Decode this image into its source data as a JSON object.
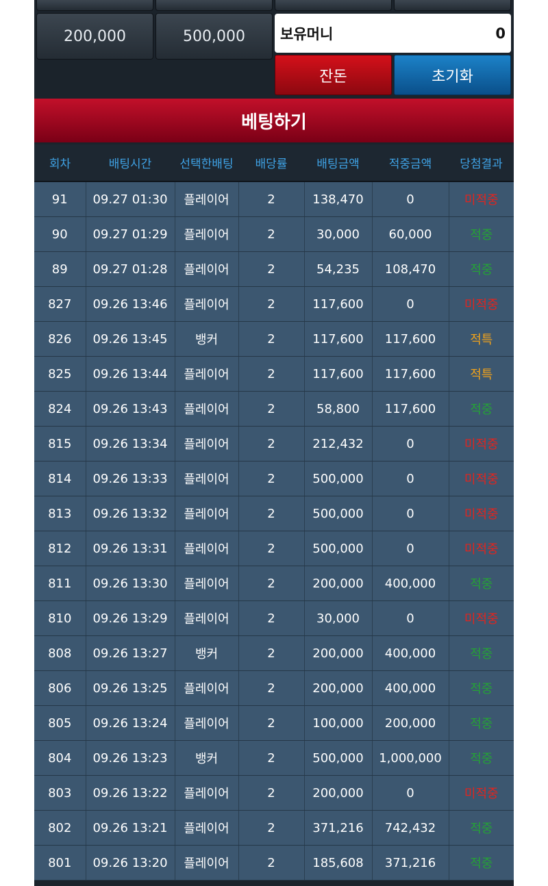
{
  "chips": {
    "row1": [
      "200,000",
      "500,000"
    ]
  },
  "balance": {
    "label": "보유머니",
    "value": "0"
  },
  "buttons": {
    "change": "잔돈",
    "reset": "초기화"
  },
  "section_title": "베팅하기",
  "table": {
    "headers": [
      "회차",
      "배팅시간",
      "선택한배팅",
      "배당률",
      "배팅금액",
      "적중금액",
      "당첨결과"
    ],
    "rows": [
      {
        "round": "91",
        "time": "09.27 01:30",
        "pick": "플레이어",
        "odds": "2",
        "bet": "138,470",
        "win": "0",
        "result": "미적중",
        "status": "lose"
      },
      {
        "round": "90",
        "time": "09.27 01:29",
        "pick": "플레이어",
        "odds": "2",
        "bet": "30,000",
        "win": "60,000",
        "result": "적중",
        "status": "win"
      },
      {
        "round": "89",
        "time": "09.27 01:28",
        "pick": "플레이어",
        "odds": "2",
        "bet": "54,235",
        "win": "108,470",
        "result": "적중",
        "status": "win"
      },
      {
        "round": "827",
        "time": "09.26 13:46",
        "pick": "플레이어",
        "odds": "2",
        "bet": "117,600",
        "win": "0",
        "result": "미적중",
        "status": "lose"
      },
      {
        "round": "826",
        "time": "09.26 13:45",
        "pick": "뱅커",
        "odds": "2",
        "bet": "117,600",
        "win": "117,600",
        "result": "적특",
        "status": "tie"
      },
      {
        "round": "825",
        "time": "09.26 13:44",
        "pick": "플레이어",
        "odds": "2",
        "bet": "117,600",
        "win": "117,600",
        "result": "적특",
        "status": "tie"
      },
      {
        "round": "824",
        "time": "09.26 13:43",
        "pick": "플레이어",
        "odds": "2",
        "bet": "58,800",
        "win": "117,600",
        "result": "적중",
        "status": "win"
      },
      {
        "round": "815",
        "time": "09.26 13:34",
        "pick": "플레이어",
        "odds": "2",
        "bet": "212,432",
        "win": "0",
        "result": "미적중",
        "status": "lose"
      },
      {
        "round": "814",
        "time": "09.26 13:33",
        "pick": "플레이어",
        "odds": "2",
        "bet": "500,000",
        "win": "0",
        "result": "미적중",
        "status": "lose"
      },
      {
        "round": "813",
        "time": "09.26 13:32",
        "pick": "플레이어",
        "odds": "2",
        "bet": "500,000",
        "win": "0",
        "result": "미적중",
        "status": "lose"
      },
      {
        "round": "812",
        "time": "09.26 13:31",
        "pick": "플레이어",
        "odds": "2",
        "bet": "500,000",
        "win": "0",
        "result": "미적중",
        "status": "lose"
      },
      {
        "round": "811",
        "time": "09.26 13:30",
        "pick": "플레이어",
        "odds": "2",
        "bet": "200,000",
        "win": "400,000",
        "result": "적중",
        "status": "win"
      },
      {
        "round": "810",
        "time": "09.26 13:29",
        "pick": "플레이어",
        "odds": "2",
        "bet": "30,000",
        "win": "0",
        "result": "미적중",
        "status": "lose"
      },
      {
        "round": "808",
        "time": "09.26 13:27",
        "pick": "뱅커",
        "odds": "2",
        "bet": "200,000",
        "win": "400,000",
        "result": "적중",
        "status": "win"
      },
      {
        "round": "806",
        "time": "09.26 13:25",
        "pick": "플레이어",
        "odds": "2",
        "bet": "200,000",
        "win": "400,000",
        "result": "적중",
        "status": "win"
      },
      {
        "round": "805",
        "time": "09.26 13:24",
        "pick": "플레이어",
        "odds": "2",
        "bet": "100,000",
        "win": "200,000",
        "result": "적중",
        "status": "win"
      },
      {
        "round": "804",
        "time": "09.26 13:23",
        "pick": "뱅커",
        "odds": "2",
        "bet": "500,000",
        "win": "1,000,000",
        "result": "적중",
        "status": "win"
      },
      {
        "round": "803",
        "time": "09.26 13:22",
        "pick": "플레이어",
        "odds": "2",
        "bet": "200,000",
        "win": "0",
        "result": "미적중",
        "status": "lose"
      },
      {
        "round": "802",
        "time": "09.26 13:21",
        "pick": "플레이어",
        "odds": "2",
        "bet": "371,216",
        "win": "742,432",
        "result": "적중",
        "status": "win"
      },
      {
        "round": "801",
        "time": "09.26 13:20",
        "pick": "플레이어",
        "odds": "2",
        "bet": "185,608",
        "win": "371,216",
        "result": "적중",
        "status": "win"
      }
    ]
  },
  "colors": {
    "lose": "#e2241e",
    "win": "#25a236",
    "tie": "#f0a21b",
    "header_text": "#3fa3e6",
    "row_bg": "#3c5770"
  }
}
